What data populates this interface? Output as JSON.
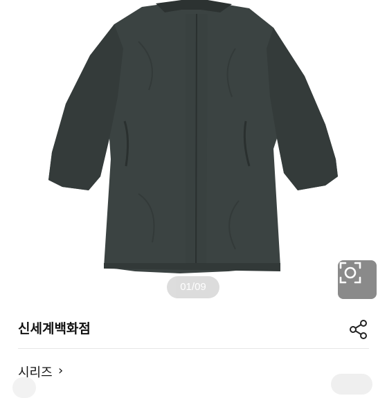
{
  "gallery": {
    "counter": "01/09",
    "lens_icon": "camera-lens-icon"
  },
  "store": {
    "name": "신세계백화점",
    "share_icon": "share-icon"
  },
  "series": {
    "label": "시리즈",
    "arrow": "›"
  },
  "colors": {
    "coat": "#3b4342",
    "counter_bg": "#d9d9d9",
    "lens_bg": "#8a8a8a"
  }
}
